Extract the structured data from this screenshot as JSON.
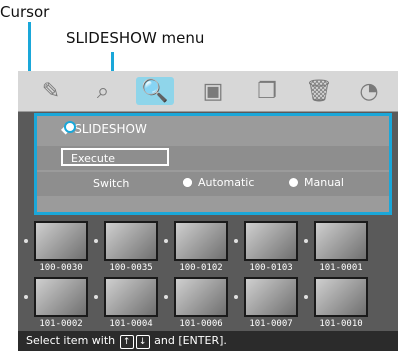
{
  "annotations": {
    "cursor": "Cursor",
    "menu": "SLIDESHOW menu"
  },
  "toolbar": {
    "icons": [
      "pen-icon",
      "magnifier-icon",
      "zoom-icon",
      "briefcase-icon",
      "copy-icon",
      "trash-icon",
      "view-icon"
    ],
    "selected": "zoom-icon"
  },
  "menu": {
    "title": "SLIDESHOW",
    "execute_label": "Execute",
    "switch_label": "Switch",
    "option_automatic": "Automatic",
    "option_manual": "Manual",
    "selected_option": "Automatic"
  },
  "thumbnails": [
    "100-0030",
    "100-0035",
    "100-0102",
    "100-0103",
    "101-0001",
    "101-0002",
    "101-0004",
    "101-0006",
    "101-0007",
    "101-0010"
  ],
  "status": {
    "prefix": "Select item with ",
    "suffix": " and [ENTER]."
  },
  "colors": {
    "highlight": "#1aa7d9",
    "menu_bg": "#9b9b9b",
    "screen_bg": "#5a5a5a"
  }
}
